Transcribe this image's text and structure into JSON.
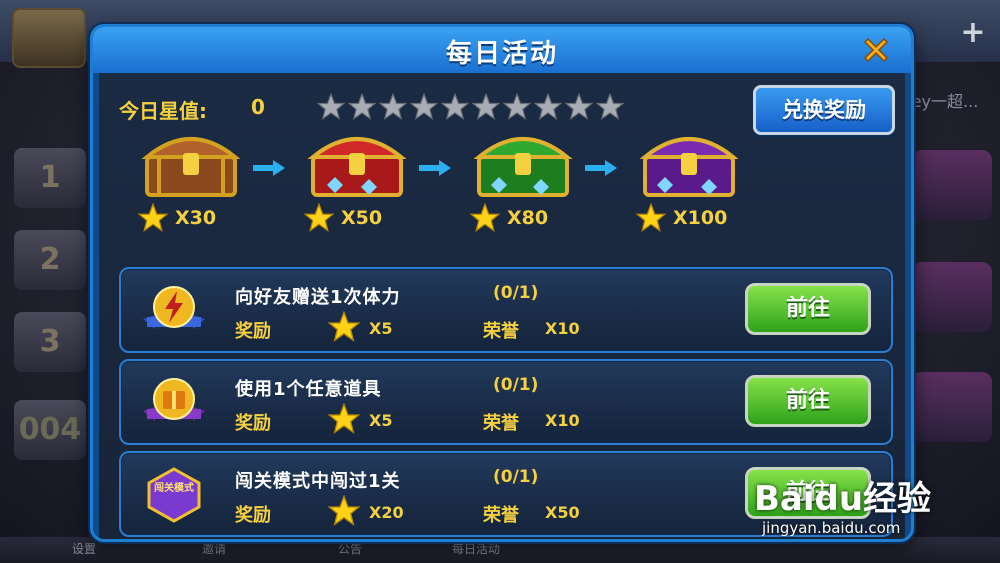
{
  "background": {
    "bottom_tabs": [
      "设置",
      "邀请",
      "公告",
      "每日活动"
    ],
    "right_text": "ey一超...",
    "rank_numbers": [
      "1",
      "2",
      "3"
    ],
    "counter": "004"
  },
  "modal": {
    "title": "每日活动",
    "star_label": "今日星值:",
    "star_value": "0",
    "star_slots_total": 10,
    "star_slots_filled": 0,
    "exchange_button": "兑换奖励",
    "chests": [
      {
        "color": "brown",
        "reward": "X30"
      },
      {
        "color": "red",
        "reward": "X50"
      },
      {
        "color": "green",
        "reward": "X80"
      },
      {
        "color": "purple",
        "reward": "X100"
      }
    ],
    "tasks": [
      {
        "title": "向好友赠送1次体力",
        "progress": "(0/1)",
        "reward_label": "奖励",
        "reward_value": "X5",
        "honor_label": "荣誉",
        "honor_value": "X10",
        "button": "前往",
        "icon": "lightning-badge-icon"
      },
      {
        "title": "使用1个任意道具",
        "progress": "(0/1)",
        "reward_label": "奖励",
        "reward_value": "X5",
        "honor_label": "荣誉",
        "honor_value": "X10",
        "button": "前往",
        "icon": "gift-box-badge-icon"
      },
      {
        "title": "闯关模式中闯过1关",
        "progress": "(0/1)",
        "reward_label": "奖励",
        "reward_value": "X20",
        "honor_label": "荣誉",
        "honor_value": "X50",
        "button": "前往",
        "icon": "stage-mode-badge-icon",
        "icon_text": "闯关模式"
      }
    ]
  },
  "watermark": {
    "logo": "Baidu经验",
    "url": "jingyan.baidu.com"
  },
  "colors": {
    "gold": "#f5d040",
    "modal_blue": "#1a6fd0",
    "go_green": "#2ea21a"
  }
}
